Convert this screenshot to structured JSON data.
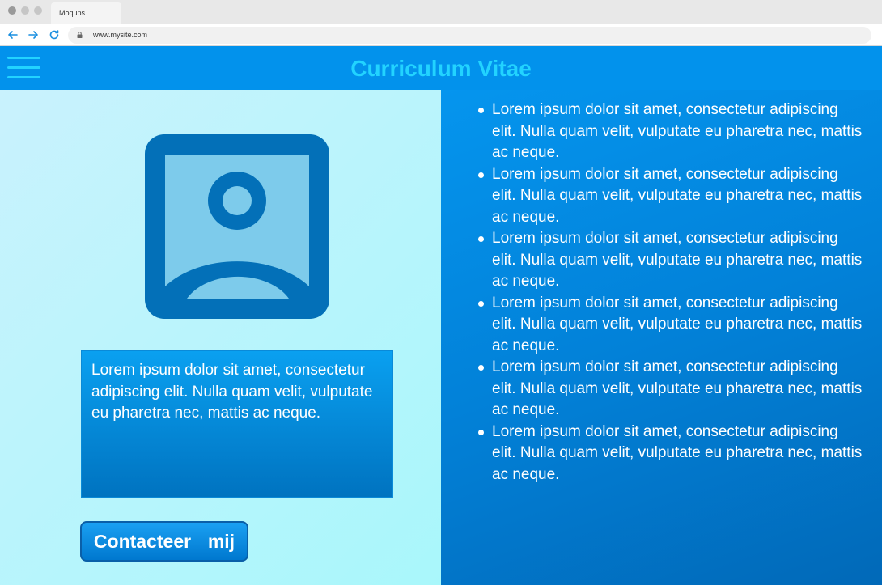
{
  "browser": {
    "tab_title": "Moqups",
    "url": "www.mysite.com"
  },
  "header": {
    "title": "Curriculum Vitae"
  },
  "profile": {
    "intro_text": "Lorem ipsum dolor sit amet, consectetur adipiscing elit. Nulla quam velit, vulputate eu pharetra nec, mattis ac neque.",
    "contact_label": "Contacteer  mij"
  },
  "cv_items": [
    "Lorem ipsum dolor sit amet, consectetur adipiscing elit. Nulla quam velit, vulputate eu pharetra nec, mattis ac neque.",
    "Lorem ipsum dolor sit amet, consectetur adipiscing elit. Nulla quam velit, vulputate eu pharetra nec, mattis ac neque.",
    "Lorem ipsum dolor sit amet, consectetur adipiscing elit. Nulla quam velit, vulputate eu pharetra nec, mattis ac neque.",
    "Lorem ipsum dolor sit amet, consectetur adipiscing elit. Nulla quam velit, vulputate eu pharetra nec, mattis ac neque.",
    "Lorem ipsum dolor sit amet, consectetur adipiscing elit. Nulla quam velit, vulputate eu pharetra nec, mattis ac neque.",
    "Lorem ipsum dolor sit amet, consectetur adipiscing elit. Nulla quam velit, vulputate eu pharetra nec, mattis ac neque."
  ],
  "icons": {
    "menu": "hamburger-menu-icon",
    "avatar": "user-portrait-icon",
    "back": "arrow-left-icon",
    "forward": "arrow-right-icon",
    "reload": "reload-icon",
    "lock": "lock-icon"
  },
  "colors": {
    "header_bg": "#0292ec",
    "title": "#22d3ff",
    "avatar_frame": "#0370b8",
    "avatar_fill": "#7dcbeb"
  }
}
